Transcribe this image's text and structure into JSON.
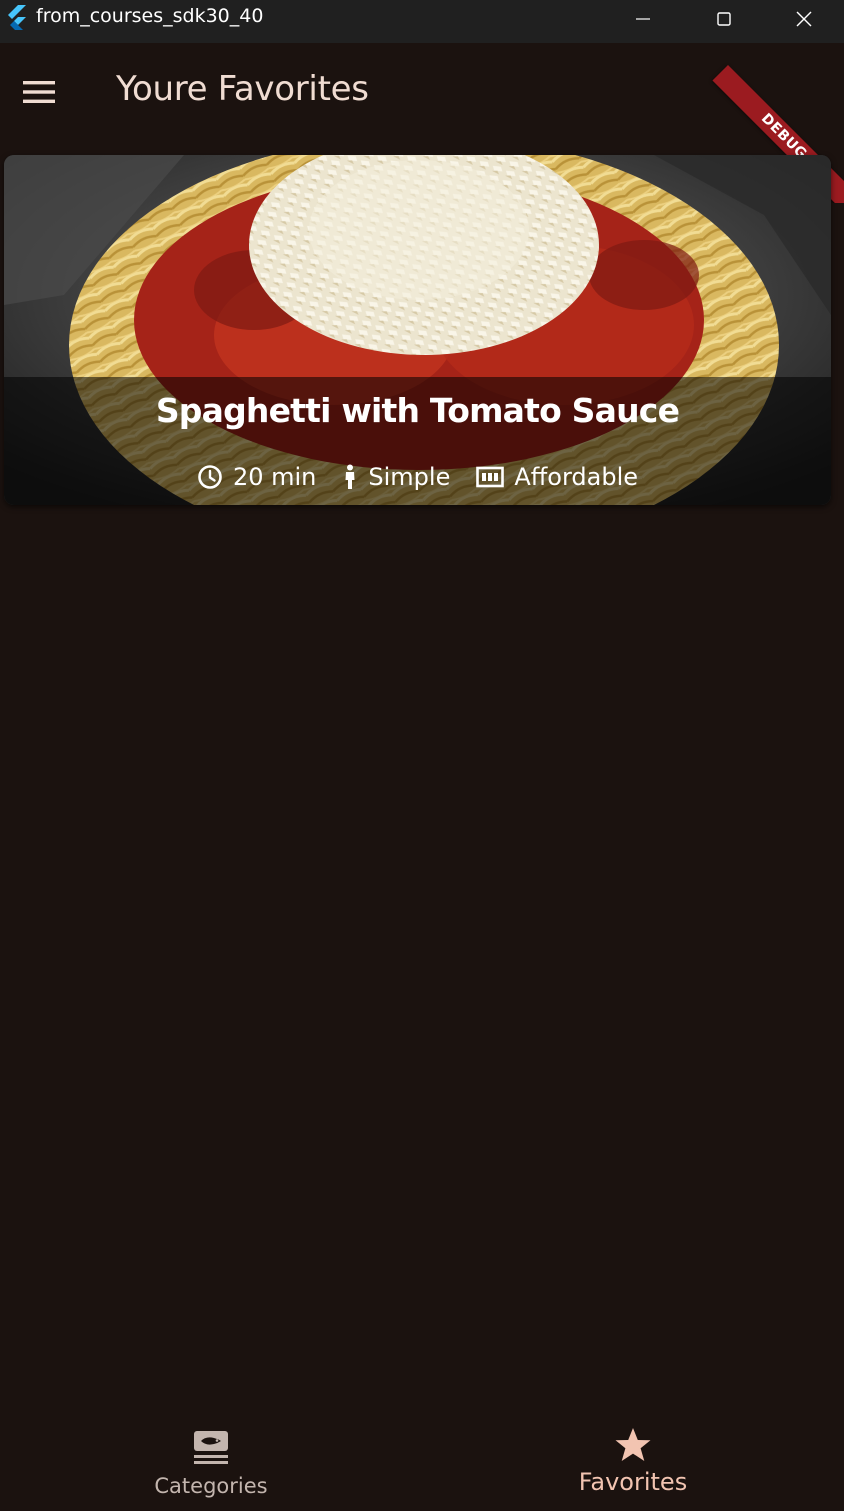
{
  "window": {
    "title": "from_courses_sdk30_40",
    "app_icon": "flutter-logo-icon",
    "controls": [
      "minimize-icon",
      "maximize-icon",
      "close-icon"
    ]
  },
  "appbar": {
    "title": "Youre Favorites",
    "menu_icon": "hamburger-menu-icon",
    "debug_banner": "DEBUG"
  },
  "favorites": [
    {
      "title": "Spaghetti with Tomato Sauce",
      "image": "spaghetti-photo",
      "duration": "20 min",
      "complexity": "Simple",
      "affordability": "Affordable",
      "icons": [
        "clock-icon",
        "person-icon",
        "money-icon"
      ]
    }
  ],
  "bottom_nav": {
    "items": [
      {
        "label": "Categories",
        "icon": "category-icon",
        "selected": false
      },
      {
        "label": "Favorites",
        "icon": "star-icon",
        "selected": true
      }
    ]
  },
  "colors": {
    "background": "#1b120f",
    "titlebar": "#202020",
    "title_text": "#f0dcd2",
    "nav_selected": "#f2c4b1",
    "nav_unselected": "#c3b5ae",
    "debug_ribbon": "#9b1b20"
  }
}
